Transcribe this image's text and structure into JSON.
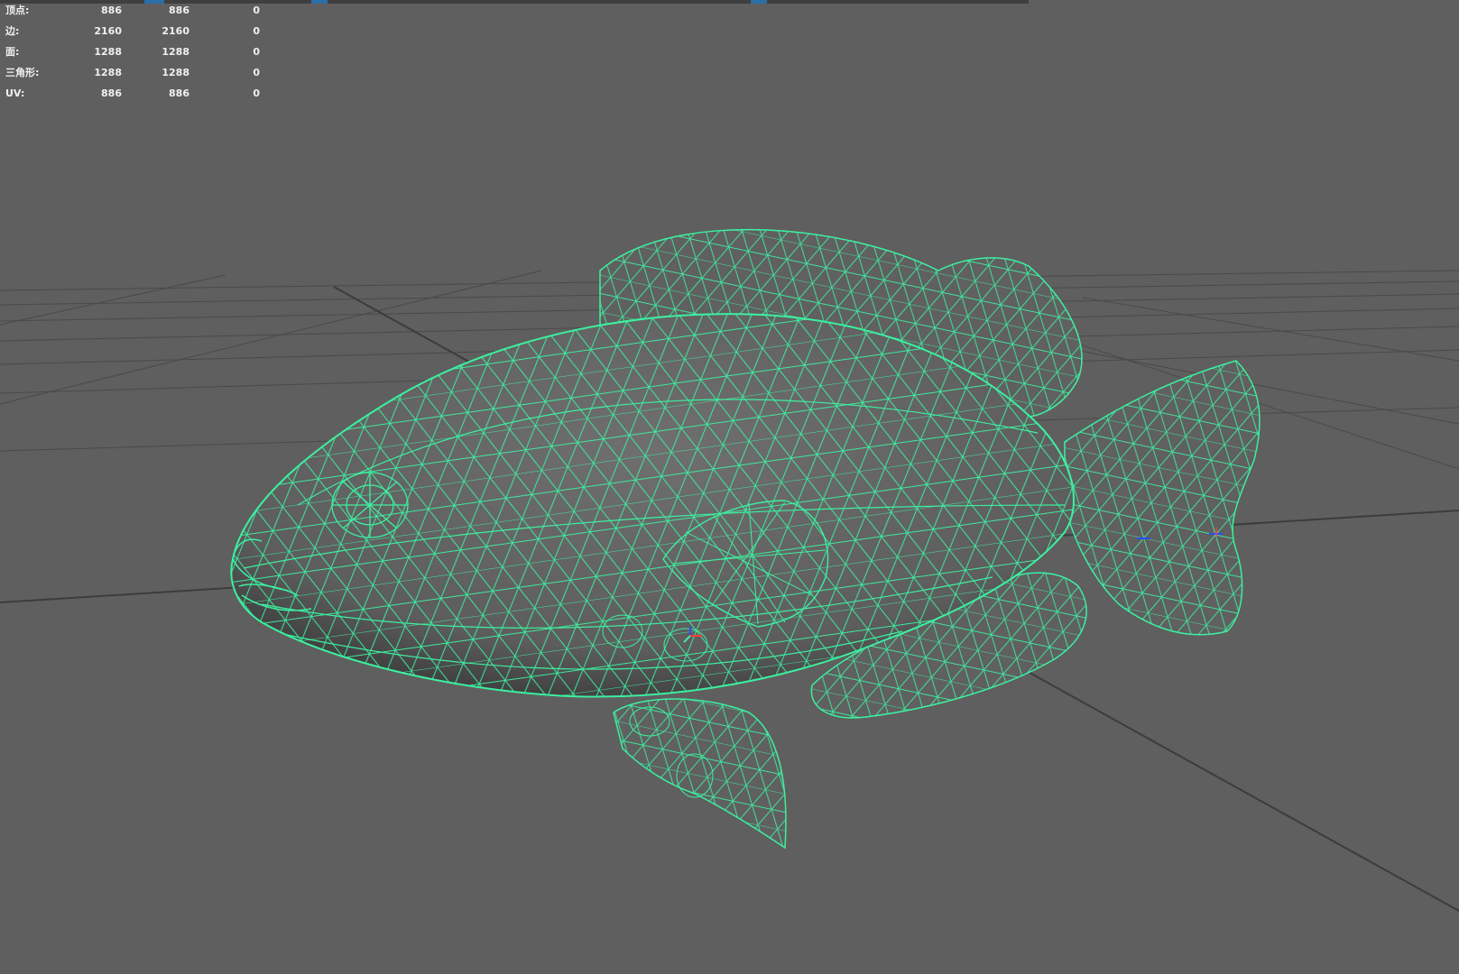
{
  "app": {
    "accent_wire": "#3cf0a0",
    "grid_color": "#474747",
    "viewport_bg": "#5f5f5f"
  },
  "hud": {
    "rows": [
      {
        "label": "顶点:",
        "c1": "886",
        "c2": "886",
        "c3": "0"
      },
      {
        "label": "边:",
        "c1": "2160",
        "c2": "2160",
        "c3": "0"
      },
      {
        "label": "面:",
        "c1": "1288",
        "c2": "1288",
        "c3": "0"
      },
      {
        "label": "三角形:",
        "c1": "1288",
        "c2": "1288",
        "c3": "0"
      },
      {
        "label": "UV:",
        "c1": "886",
        "c2": "886",
        "c3": "0"
      }
    ]
  },
  "model": {
    "icon": "fish-wireframe-mesh",
    "display_mode": "wireframe on shaded"
  }
}
